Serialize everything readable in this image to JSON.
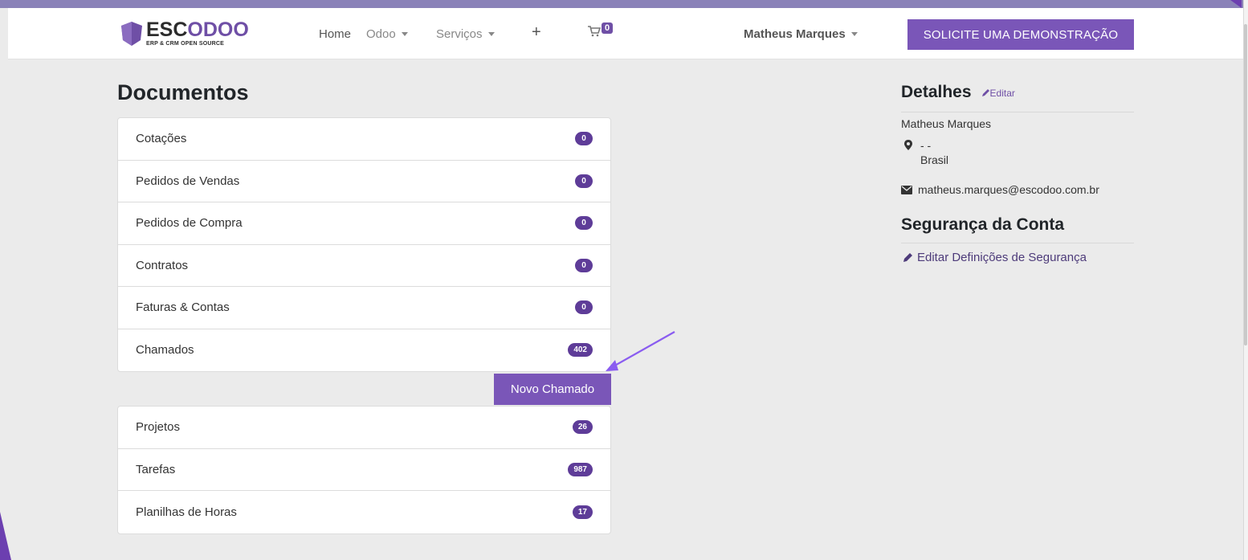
{
  "navbar": {
    "logo_main_a": "ESC",
    "logo_main_b": "ODOO",
    "logo_sub": "ERP & CRM OPEN SOURCE",
    "home": "Home",
    "odoo": "Odoo",
    "services": "Serviços",
    "plus": "+",
    "cart_count": "0",
    "user": "Matheus Marques",
    "demo_button": "SOLICITE UMA DEMONSTRAÇÃO"
  },
  "documents": {
    "title": "Documentos",
    "group1": [
      {
        "label": "Cotações",
        "count": "0"
      },
      {
        "label": "Pedidos de Vendas",
        "count": "0"
      },
      {
        "label": "Pedidos de Compra",
        "count": "0"
      },
      {
        "label": "Contratos",
        "count": "0"
      },
      {
        "label": "Faturas & Contas",
        "count": "0"
      },
      {
        "label": "Chamados",
        "count": "402"
      }
    ],
    "new_ticket_button": "Novo Chamado",
    "group2": [
      {
        "label": "Projetos",
        "count": "26"
      },
      {
        "label": "Tarefas",
        "count": "987"
      },
      {
        "label": "Planilhas de Horas",
        "count": "17"
      }
    ]
  },
  "details": {
    "title": "Detalhes",
    "edit": "Editar",
    "name": "Matheus Marques",
    "addr_line1": "- -",
    "addr_line2": "Brasil",
    "email": "matheus.marques@escodoo.com.br"
  },
  "security": {
    "title": "Segurança da Conta",
    "edit_link": "Editar Definições de Segurança"
  },
  "colors": {
    "accent": "#7a56b8",
    "badge": "#5e3c98",
    "arrow": "#8a5cf0"
  }
}
